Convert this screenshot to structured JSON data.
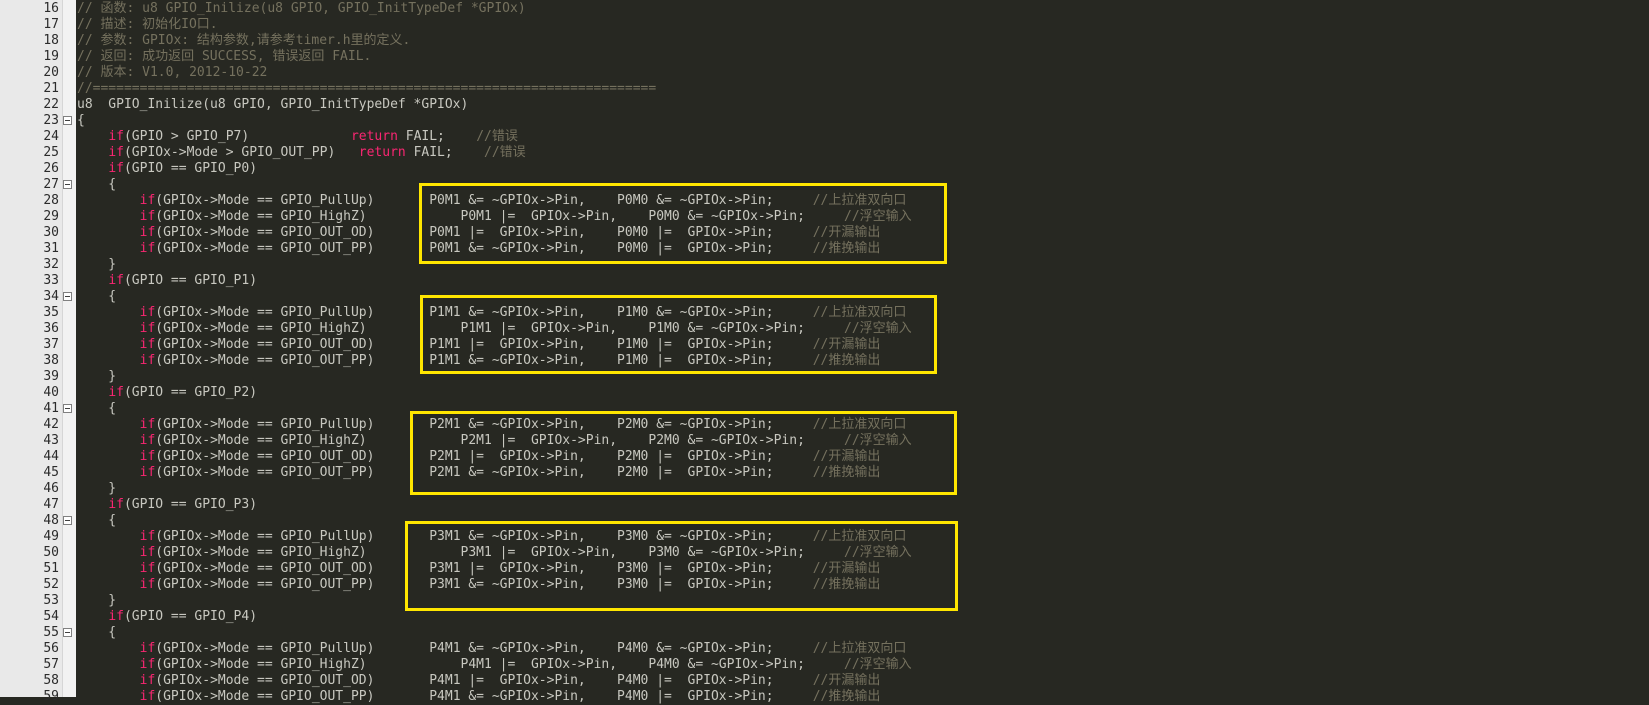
{
  "editor": {
    "colors": {
      "background": "#272822",
      "comment": "#75715e",
      "keyword": "#f92672",
      "text": "#c8c8c0",
      "highlight": "#ffe600"
    },
    "lines": [
      {
        "n": "16",
        "fold": false,
        "segs": [
          {
            "t": "// 函数: u8 GPIO_Inilize(u8 GPIO, GPIO_InitTypeDef *GPIOx)",
            "c": "comment"
          }
        ]
      },
      {
        "n": "17",
        "fold": false,
        "segs": [
          {
            "t": "// 描述: 初始化IO口.",
            "c": "comment"
          }
        ]
      },
      {
        "n": "18",
        "fold": false,
        "segs": [
          {
            "t": "// 参数: GPIOx: 结构参数,请参考timer.h里的定义.",
            "c": "comment"
          }
        ]
      },
      {
        "n": "19",
        "fold": false,
        "segs": [
          {
            "t": "// 返回: 成功返回 SUCCESS, 错误返回 FAIL.",
            "c": "comment"
          }
        ]
      },
      {
        "n": "20",
        "fold": false,
        "segs": [
          {
            "t": "// 版本: V1.0, 2012-10-22",
            "c": "comment"
          }
        ]
      },
      {
        "n": "21",
        "fold": false,
        "segs": [
          {
            "t": "//========================================================================",
            "c": "comment"
          }
        ]
      },
      {
        "n": "22",
        "fold": false,
        "segs": [
          {
            "t": "u8  GPIO_Inilize(u8 GPIO, GPIO_InitTypeDef *GPIOx)",
            "c": "text"
          }
        ]
      },
      {
        "n": "23",
        "fold": true,
        "segs": [
          {
            "t": "{",
            "c": "text"
          }
        ]
      },
      {
        "n": "24",
        "fold": false,
        "segs": [
          {
            "t": "    ",
            "c": "text"
          },
          {
            "t": "if",
            "c": "keyword"
          },
          {
            "t": "(GPIO > GPIO_P7)             ",
            "c": "text"
          },
          {
            "t": "return",
            "c": "keyword"
          },
          {
            "t": " FAIL;    ",
            "c": "text"
          },
          {
            "t": "//错误",
            "c": "comment"
          }
        ]
      },
      {
        "n": "25",
        "fold": false,
        "segs": [
          {
            "t": "    ",
            "c": "text"
          },
          {
            "t": "if",
            "c": "keyword"
          },
          {
            "t": "(GPIOx->Mode > GPIO_OUT_PP)   ",
            "c": "text"
          },
          {
            "t": "return",
            "c": "keyword"
          },
          {
            "t": " FAIL;    ",
            "c": "text"
          },
          {
            "t": "//错误",
            "c": "comment"
          }
        ]
      },
      {
        "n": "26",
        "fold": false,
        "segs": [
          {
            "t": "    ",
            "c": "text"
          },
          {
            "t": "if",
            "c": "keyword"
          },
          {
            "t": "(GPIO == GPIO_P0)",
            "c": "text"
          }
        ]
      },
      {
        "n": "27",
        "fold": true,
        "segs": [
          {
            "t": "    {",
            "c": "text"
          }
        ]
      },
      {
        "n": "28",
        "fold": false,
        "segs": [
          {
            "t": "        ",
            "c": "text"
          },
          {
            "t": "if",
            "c": "keyword"
          },
          {
            "t": "(GPIOx->Mode == GPIO_PullUp)       P0M1 &= ~GPIOx->Pin,    P0M0 &= ~GPIOx->Pin;     ",
            "c": "text"
          },
          {
            "t": "//上拉准双向口",
            "c": "comment"
          }
        ]
      },
      {
        "n": "29",
        "fold": false,
        "segs": [
          {
            "t": "        ",
            "c": "text"
          },
          {
            "t": "if",
            "c": "keyword"
          },
          {
            "t": "(GPIOx->Mode == GPIO_HighZ)            P0M1 |=  GPIOx->Pin,    P0M0 &= ~GPIOx->Pin;     ",
            "c": "text"
          },
          {
            "t": "//浮空输入",
            "c": "comment"
          }
        ]
      },
      {
        "n": "30",
        "fold": false,
        "segs": [
          {
            "t": "        ",
            "c": "text"
          },
          {
            "t": "if",
            "c": "keyword"
          },
          {
            "t": "(GPIOx->Mode == GPIO_OUT_OD)       P0M1 |=  GPIOx->Pin,    P0M0 |=  GPIOx->Pin;     ",
            "c": "text"
          },
          {
            "t": "//开漏输出",
            "c": "comment"
          }
        ]
      },
      {
        "n": "31",
        "fold": false,
        "segs": [
          {
            "t": "        ",
            "c": "text"
          },
          {
            "t": "if",
            "c": "keyword"
          },
          {
            "t": "(GPIOx->Mode == GPIO_OUT_PP)       P0M1 &= ~GPIOx->Pin,    P0M0 |=  GPIOx->Pin;     ",
            "c": "text"
          },
          {
            "t": "//推挽输出",
            "c": "comment"
          }
        ]
      },
      {
        "n": "32",
        "fold": false,
        "segs": [
          {
            "t": "    }",
            "c": "text"
          }
        ]
      },
      {
        "n": "33",
        "fold": false,
        "segs": [
          {
            "t": "    ",
            "c": "text"
          },
          {
            "t": "if",
            "c": "keyword"
          },
          {
            "t": "(GPIO == GPIO_P1)",
            "c": "text"
          }
        ]
      },
      {
        "n": "34",
        "fold": true,
        "segs": [
          {
            "t": "    {",
            "c": "text"
          }
        ]
      },
      {
        "n": "35",
        "fold": false,
        "segs": [
          {
            "t": "        ",
            "c": "text"
          },
          {
            "t": "if",
            "c": "keyword"
          },
          {
            "t": "(GPIOx->Mode == GPIO_PullUp)       P1M1 &= ~GPIOx->Pin,    P1M0 &= ~GPIOx->Pin;     ",
            "c": "text"
          },
          {
            "t": "//上拉准双向口",
            "c": "comment"
          }
        ]
      },
      {
        "n": "36",
        "fold": false,
        "segs": [
          {
            "t": "        ",
            "c": "text"
          },
          {
            "t": "if",
            "c": "keyword"
          },
          {
            "t": "(GPIOx->Mode == GPIO_HighZ)            P1M1 |=  GPIOx->Pin,    P1M0 &= ~GPIOx->Pin;     ",
            "c": "text"
          },
          {
            "t": "//浮空输入",
            "c": "comment"
          }
        ]
      },
      {
        "n": "37",
        "fold": false,
        "segs": [
          {
            "t": "        ",
            "c": "text"
          },
          {
            "t": "if",
            "c": "keyword"
          },
          {
            "t": "(GPIOx->Mode == GPIO_OUT_OD)       P1M1 |=  GPIOx->Pin,    P1M0 |=  GPIOx->Pin;     ",
            "c": "text"
          },
          {
            "t": "//开漏输出",
            "c": "comment"
          }
        ]
      },
      {
        "n": "38",
        "fold": false,
        "segs": [
          {
            "t": "        ",
            "c": "text"
          },
          {
            "t": "if",
            "c": "keyword"
          },
          {
            "t": "(GPIOx->Mode == GPIO_OUT_PP)       P1M1 &= ~GPIOx->Pin,    P1M0 |=  GPIOx->Pin;     ",
            "c": "text"
          },
          {
            "t": "//推挽输出",
            "c": "comment"
          }
        ]
      },
      {
        "n": "39",
        "fold": false,
        "segs": [
          {
            "t": "    }",
            "c": "text"
          }
        ]
      },
      {
        "n": "40",
        "fold": false,
        "segs": [
          {
            "t": "    ",
            "c": "text"
          },
          {
            "t": "if",
            "c": "keyword"
          },
          {
            "t": "(GPIO == GPIO_P2)",
            "c": "text"
          }
        ]
      },
      {
        "n": "41",
        "fold": true,
        "segs": [
          {
            "t": "    {",
            "c": "text"
          }
        ]
      },
      {
        "n": "42",
        "fold": false,
        "segs": [
          {
            "t": "        ",
            "c": "text"
          },
          {
            "t": "if",
            "c": "keyword"
          },
          {
            "t": "(GPIOx->Mode == GPIO_PullUp)       P2M1 &= ~GPIOx->Pin,    P2M0 &= ~GPIOx->Pin;     ",
            "c": "text"
          },
          {
            "t": "//上拉准双向口",
            "c": "comment"
          }
        ]
      },
      {
        "n": "43",
        "fold": false,
        "segs": [
          {
            "t": "        ",
            "c": "text"
          },
          {
            "t": "if",
            "c": "keyword"
          },
          {
            "t": "(GPIOx->Mode == GPIO_HighZ)            P2M1 |=  GPIOx->Pin,    P2M0 &= ~GPIOx->Pin;     ",
            "c": "text"
          },
          {
            "t": "//浮空输入",
            "c": "comment"
          }
        ]
      },
      {
        "n": "44",
        "fold": false,
        "segs": [
          {
            "t": "        ",
            "c": "text"
          },
          {
            "t": "if",
            "c": "keyword"
          },
          {
            "t": "(GPIOx->Mode == GPIO_OUT_OD)       P2M1 |=  GPIOx->Pin,    P2M0 |=  GPIOx->Pin;     ",
            "c": "text"
          },
          {
            "t": "//开漏输出",
            "c": "comment"
          }
        ]
      },
      {
        "n": "45",
        "fold": false,
        "segs": [
          {
            "t": "        ",
            "c": "text"
          },
          {
            "t": "if",
            "c": "keyword"
          },
          {
            "t": "(GPIOx->Mode == GPIO_OUT_PP)       P2M1 &= ~GPIOx->Pin,    P2M0 |=  GPIOx->Pin;     ",
            "c": "text"
          },
          {
            "t": "//推挽输出",
            "c": "comment"
          }
        ]
      },
      {
        "n": "46",
        "fold": false,
        "segs": [
          {
            "t": "    }",
            "c": "text"
          }
        ]
      },
      {
        "n": "47",
        "fold": false,
        "segs": [
          {
            "t": "    ",
            "c": "text"
          },
          {
            "t": "if",
            "c": "keyword"
          },
          {
            "t": "(GPIO == GPIO_P3)",
            "c": "text"
          }
        ]
      },
      {
        "n": "48",
        "fold": true,
        "segs": [
          {
            "t": "    {",
            "c": "text"
          }
        ]
      },
      {
        "n": "49",
        "fold": false,
        "segs": [
          {
            "t": "        ",
            "c": "text"
          },
          {
            "t": "if",
            "c": "keyword"
          },
          {
            "t": "(GPIOx->Mode == GPIO_PullUp)       P3M1 &= ~GPIOx->Pin,    P3M0 &= ~GPIOx->Pin;     ",
            "c": "text"
          },
          {
            "t": "//上拉准双向口",
            "c": "comment"
          }
        ]
      },
      {
        "n": "50",
        "fold": false,
        "segs": [
          {
            "t": "        ",
            "c": "text"
          },
          {
            "t": "if",
            "c": "keyword"
          },
          {
            "t": "(GPIOx->Mode == GPIO_HighZ)            P3M1 |=  GPIOx->Pin,    P3M0 &= ~GPIOx->Pin;     ",
            "c": "text"
          },
          {
            "t": "//浮空输入",
            "c": "comment"
          }
        ]
      },
      {
        "n": "51",
        "fold": false,
        "segs": [
          {
            "t": "        ",
            "c": "text"
          },
          {
            "t": "if",
            "c": "keyword"
          },
          {
            "t": "(GPIOx->Mode == GPIO_OUT_OD)       P3M1 |=  GPIOx->Pin,    P3M0 |=  GPIOx->Pin;     ",
            "c": "text"
          },
          {
            "t": "//开漏输出",
            "c": "comment"
          }
        ]
      },
      {
        "n": "52",
        "fold": false,
        "segs": [
          {
            "t": "        ",
            "c": "text"
          },
          {
            "t": "if",
            "c": "keyword"
          },
          {
            "t": "(GPIOx->Mode == GPIO_OUT_PP)       P3M1 &= ~GPIOx->Pin,    P3M0 |=  GPIOx->Pin;     ",
            "c": "text"
          },
          {
            "t": "//推挽输出",
            "c": "comment"
          }
        ]
      },
      {
        "n": "53",
        "fold": false,
        "segs": [
          {
            "t": "    }",
            "c": "text"
          }
        ]
      },
      {
        "n": "54",
        "fold": false,
        "segs": [
          {
            "t": "    ",
            "c": "text"
          },
          {
            "t": "if",
            "c": "keyword"
          },
          {
            "t": "(GPIO == GPIO_P4)",
            "c": "text"
          }
        ]
      },
      {
        "n": "55",
        "fold": true,
        "segs": [
          {
            "t": "    {",
            "c": "text"
          }
        ]
      },
      {
        "n": "56",
        "fold": false,
        "segs": [
          {
            "t": "        ",
            "c": "text"
          },
          {
            "t": "if",
            "c": "keyword"
          },
          {
            "t": "(GPIOx->Mode == GPIO_PullUp)       P4M1 &= ~GPIOx->Pin,    P4M0 &= ~GPIOx->Pin;     ",
            "c": "text"
          },
          {
            "t": "//上拉准双向口",
            "c": "comment"
          }
        ]
      },
      {
        "n": "57",
        "fold": false,
        "segs": [
          {
            "t": "        ",
            "c": "text"
          },
          {
            "t": "if",
            "c": "keyword"
          },
          {
            "t": "(GPIOx->Mode == GPIO_HighZ)            P4M1 |=  GPIOx->Pin,    P4M0 &= ~GPIOx->Pin;     ",
            "c": "text"
          },
          {
            "t": "//浮空输入",
            "c": "comment"
          }
        ]
      },
      {
        "n": "58",
        "fold": false,
        "segs": [
          {
            "t": "        ",
            "c": "text"
          },
          {
            "t": "if",
            "c": "keyword"
          },
          {
            "t": "(GPIOx->Mode == GPIO_OUT_OD)       P4M1 |=  GPIOx->Pin,    P4M0 |=  GPIOx->Pin;     ",
            "c": "text"
          },
          {
            "t": "//开漏输出",
            "c": "comment"
          }
        ]
      },
      {
        "n": "59",
        "fold": false,
        "segs": [
          {
            "t": "        ",
            "c": "text"
          },
          {
            "t": "if",
            "c": "keyword"
          },
          {
            "t": "(GPIOx->Mode == GPIO_OUT_PP)       P4M1 &= ~GPIOx->Pin,    P4M0 |=  GPIOx->Pin;     ",
            "c": "text"
          },
          {
            "t": "//推挽输出",
            "c": "comment"
          }
        ]
      }
    ]
  }
}
